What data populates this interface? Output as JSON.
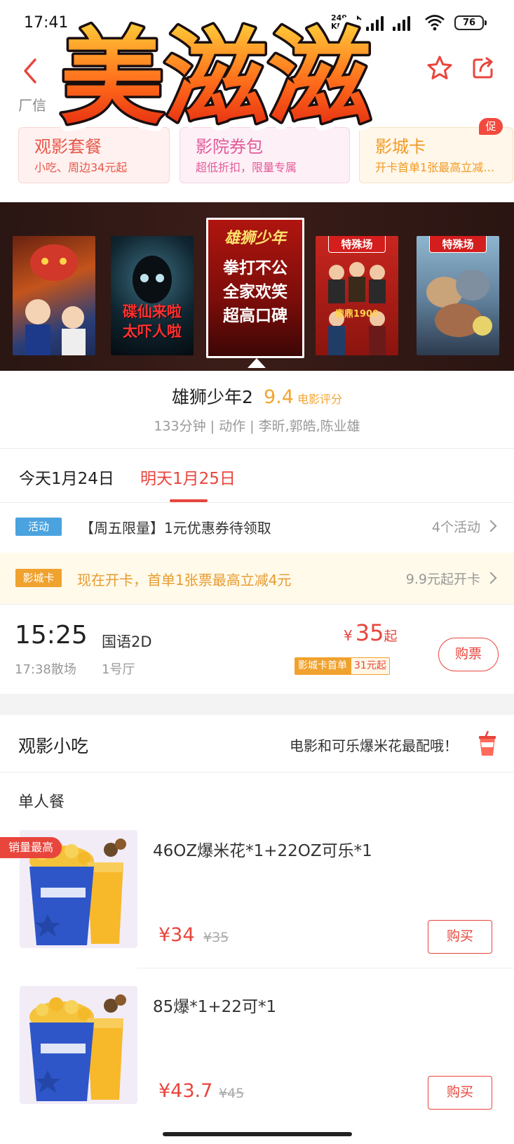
{
  "status_bar": {
    "time": "17:41",
    "net_speed_value": "249",
    "net_speed_unit": "KB/s",
    "battery": "76"
  },
  "header": {
    "partial_address": "厂信"
  },
  "overlay": {
    "watermark_text": "美滋滋"
  },
  "promos": [
    {
      "title": "观影套餐",
      "subtitle": "小吃、周边34元起"
    },
    {
      "title": "影院券包",
      "subtitle": "超低折扣，限量专属"
    },
    {
      "title": "影城卡",
      "subtitle": "开卡首单1张最高立减4元"
    }
  ],
  "promo_badge": "促",
  "posters": [
    {
      "text": "",
      "tag": ""
    },
    {
      "text": "碟仙来啦\n太吓人啦",
      "tag": ""
    },
    {
      "text": "拳打不公\n全家欢笑\n超高口碑",
      "tag": ""
    },
    {
      "text": "",
      "tag": "特殊场"
    },
    {
      "text": "",
      "tag": "特殊场"
    }
  ],
  "poster_art": {
    "sel_title": "雄狮少年",
    "p4_title": "鹿鼎1900"
  },
  "movie": {
    "title": "雄狮少年2",
    "score": "9.4",
    "score_label": "电影评分",
    "meta": "133分钟 | 动作 | 李昕,郭皓,陈业雄"
  },
  "dates": {
    "today": "今天1月24日",
    "tomorrow": "明天1月25日"
  },
  "activity": {
    "badge": "活动",
    "text": "【周五限量】1元优惠券待领取",
    "count": "4个活动"
  },
  "card_row": {
    "badge": "影城卡",
    "text": "现在开卡，首单1张票最高立减4元",
    "price": "9.9元起开卡"
  },
  "showtime": {
    "start": "15:25",
    "end": "17:38散场",
    "language": "国语2D",
    "hall": "1号厅",
    "currency": "¥",
    "price": "35",
    "price_suffix": "起",
    "card_label": "影城卡首单",
    "card_price": "31元起",
    "buy_label": "购票"
  },
  "snacks": {
    "title": "观影小吃",
    "slogan": "电影和可乐爆米花最配哦！",
    "section": "单人餐",
    "items": [
      {
        "tag": "销量最高",
        "name": "46OZ爆米花*1+22OZ可乐*1",
        "price": "¥34",
        "original": "¥35",
        "buy": "购买"
      },
      {
        "tag": "",
        "name": "85爆*1+22可*1",
        "price": "¥43.7",
        "original": "¥45",
        "buy": "购买"
      }
    ]
  },
  "colors": {
    "accent": "#e8453c",
    "score": "#f3a530",
    "activity_badge": "#4aa3df",
    "card_badge": "#f0a22e"
  },
  "icons": [
    "back-icon",
    "star-icon",
    "share-icon",
    "chevron-right-icon",
    "cup-icon",
    "wifi-icon",
    "signal-icon",
    "nfc-icon"
  ]
}
